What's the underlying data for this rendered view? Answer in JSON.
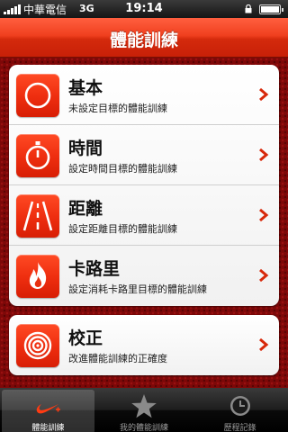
{
  "status_bar": {
    "carrier": "中華電信",
    "network": "3G",
    "time": "19:14"
  },
  "nav": {
    "title": "體能訓練"
  },
  "workouts": [
    {
      "title": "基本",
      "subtitle": "未設定目標的體能訓練",
      "icon": "circle-icon"
    },
    {
      "title": "時間",
      "subtitle": "設定時間目標的體能訓練",
      "icon": "stopwatch-icon"
    },
    {
      "title": "距離",
      "subtitle": "設定距離目標的體能訓練",
      "icon": "road-icon"
    },
    {
      "title": "卡路里",
      "subtitle": "設定消耗卡路里目標的體能訓練",
      "icon": "flame-icon"
    }
  ],
  "calibrate": {
    "title": "校正",
    "subtitle": "改進體能訓練的正確度",
    "icon": "target-icon"
  },
  "tabs": [
    {
      "label": "體能訓練",
      "icon": "nike-swoosh-icon",
      "active": true
    },
    {
      "label": "我的體能訓練",
      "icon": "star-icon",
      "active": false
    },
    {
      "label": "歷程記錄",
      "icon": "clock-icon",
      "active": false
    }
  ],
  "colors": {
    "accent": "#e8300f",
    "background": "#7e0808"
  }
}
